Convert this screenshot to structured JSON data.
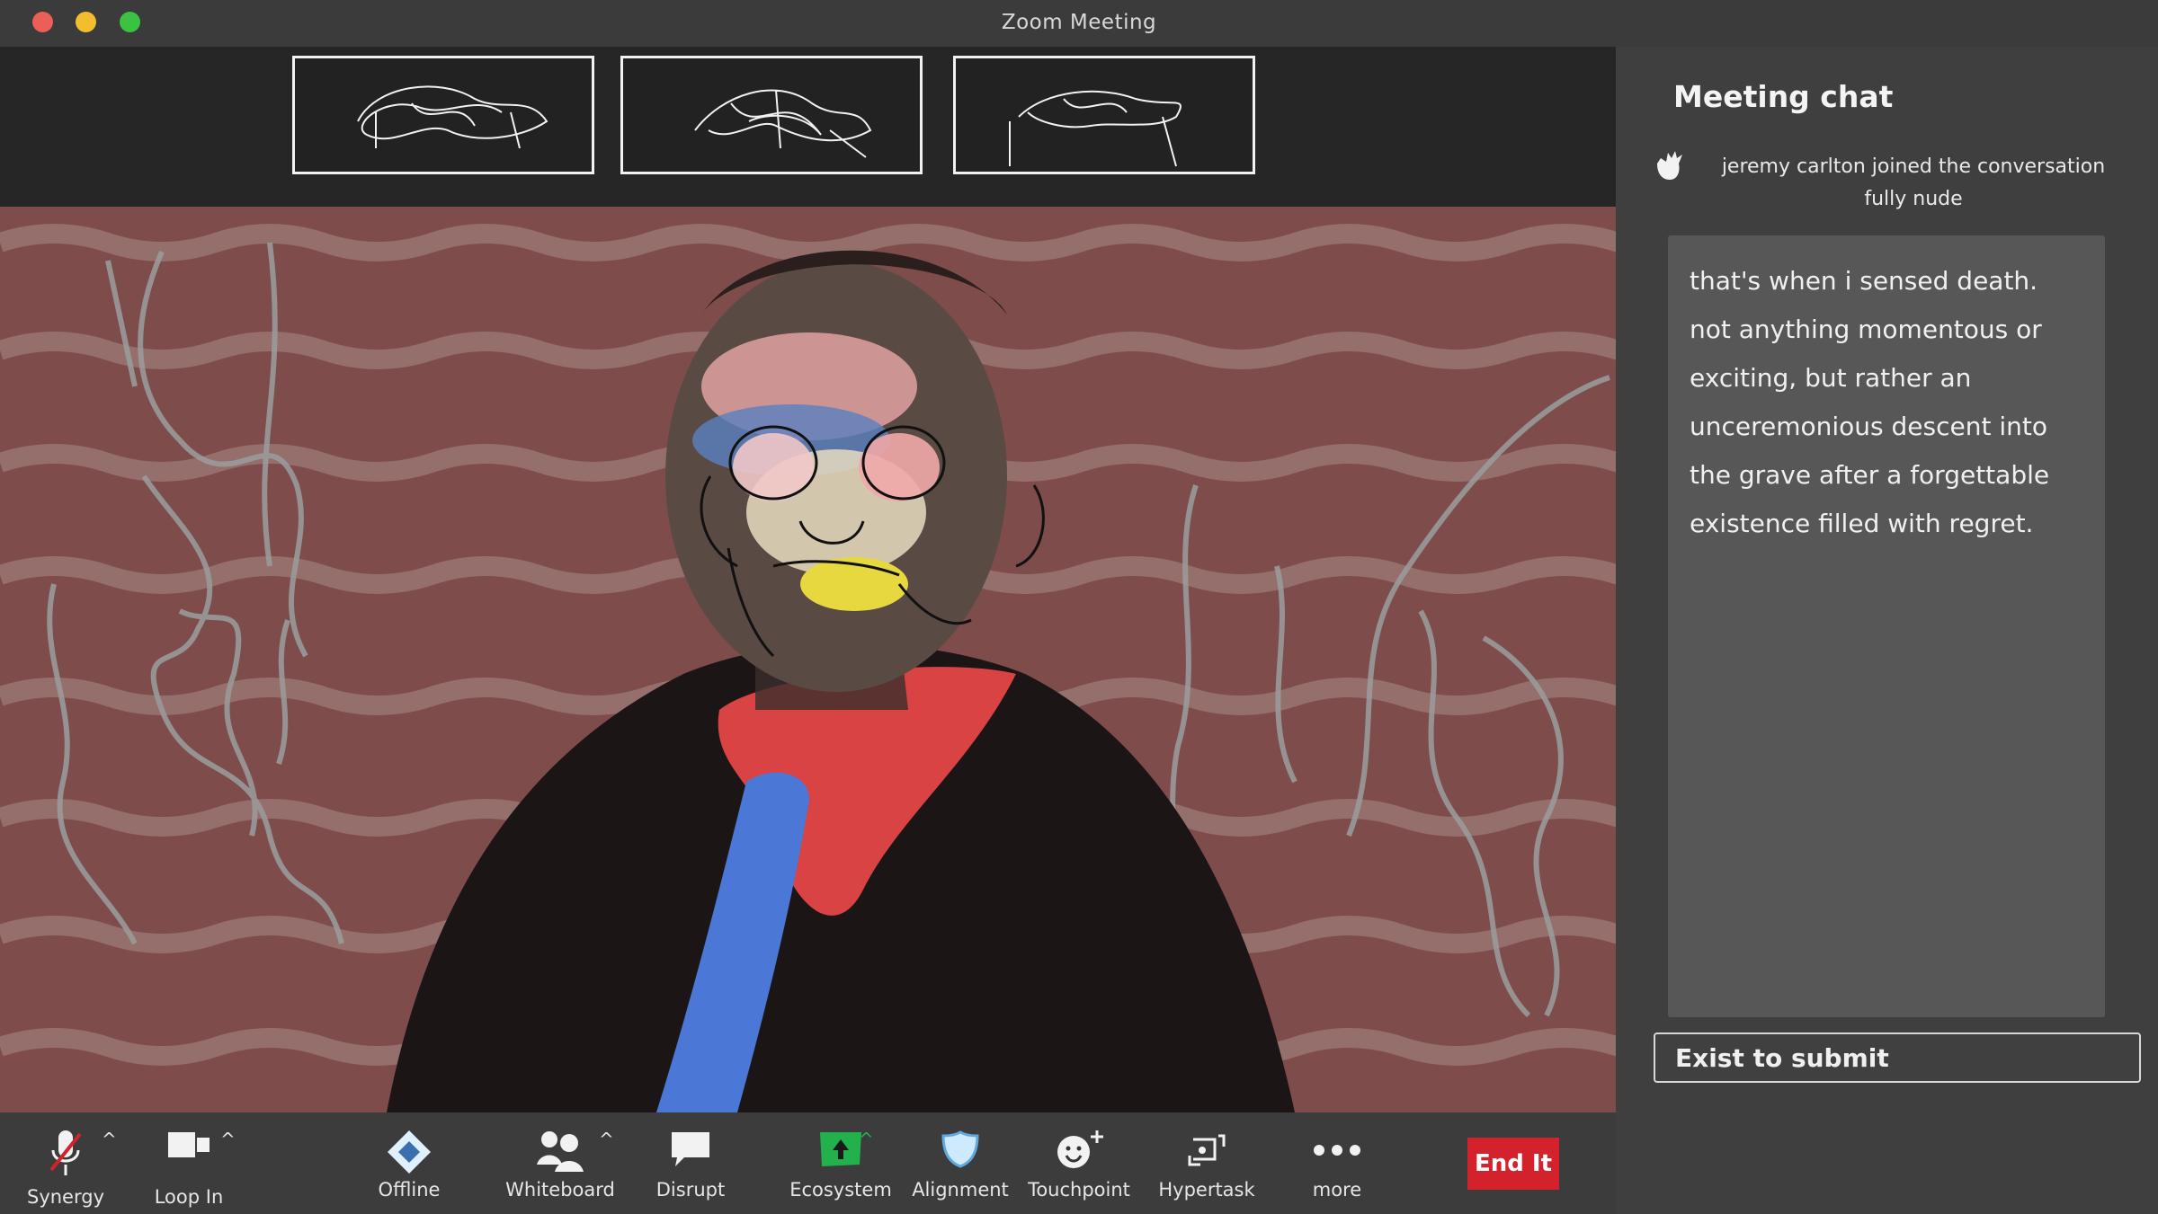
{
  "window": {
    "title": "Zoom Meeting"
  },
  "thumbnails": [
    {
      "name": "participant-1"
    },
    {
      "name": "participant-2"
    },
    {
      "name": "participant-3"
    }
  ],
  "chat": {
    "title": "Meeting chat",
    "joined_notice": "jeremy carlton  joined the conversation fully nude",
    "message": "that's when i sensed death. not anything momentous or exciting, but rather an unceremonious descent into the grave after a forgettable existence filled with regret.",
    "input_placeholder": "Exist to submit"
  },
  "toolbar": {
    "synergy": "Synergy",
    "loop_in": "Loop In",
    "offline": "Offline",
    "whiteboard": "Whiteboard",
    "disrupt": "Disrupt",
    "ecosystem": "Ecosystem",
    "alignment": "Alignment",
    "touchpoint": "Touchpoint",
    "hypertask": "Hypertask",
    "more": "more",
    "end": "End It"
  },
  "colors": {
    "end_button": "#d4222c",
    "ecosystem_icon": "#22b14c",
    "video_background": "#7d4c4b"
  }
}
